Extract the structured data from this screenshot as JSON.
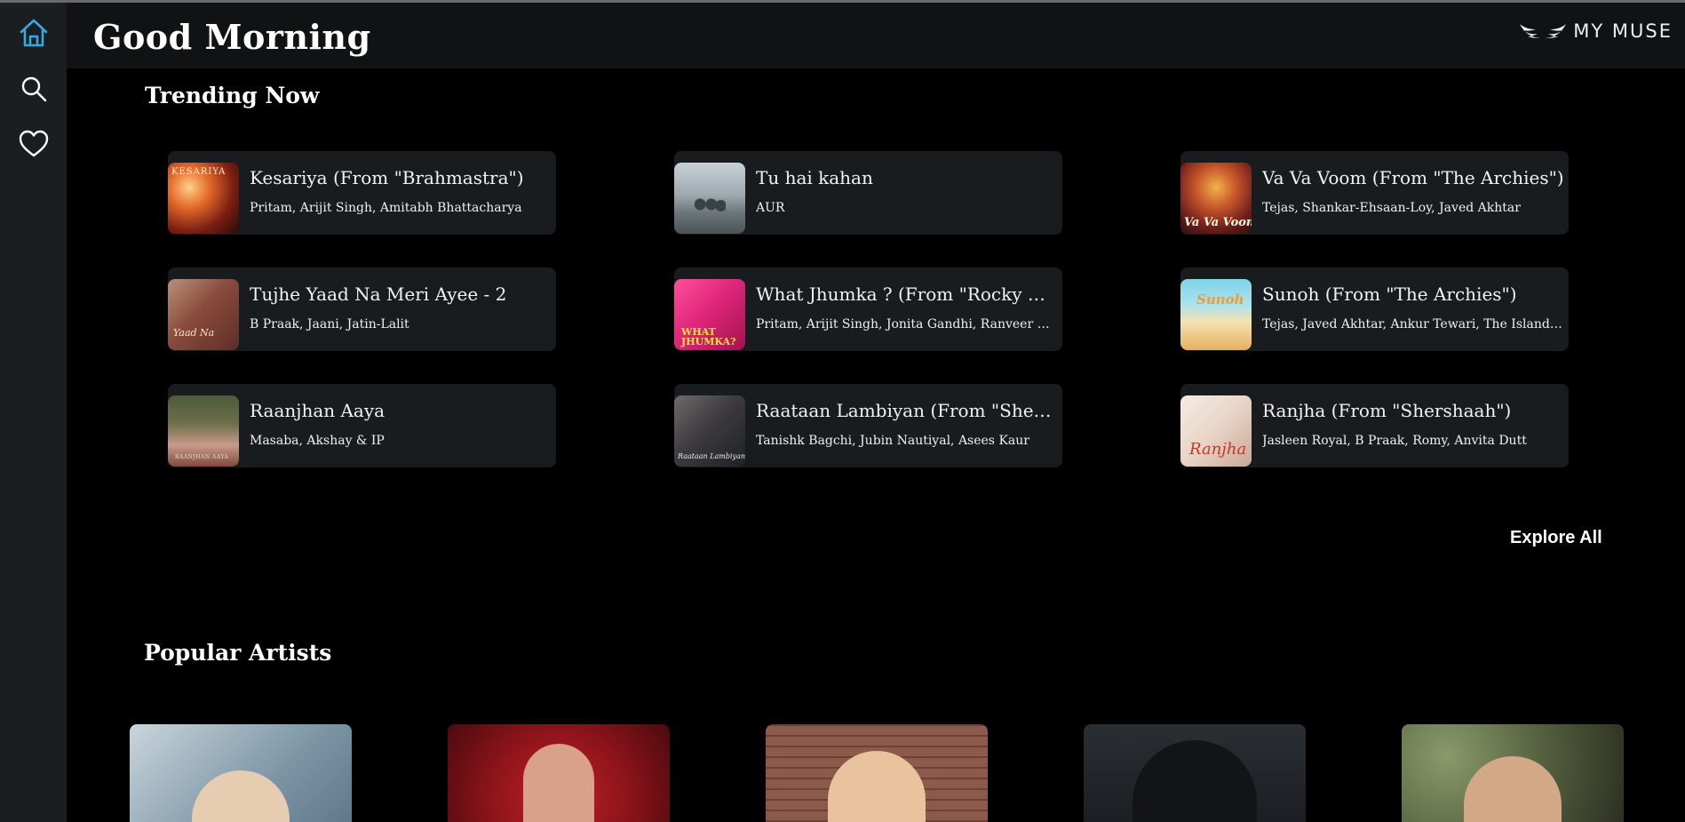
{
  "header": {
    "greeting": "Good Morning",
    "logo_text": "MY MUSE"
  },
  "sidebar": {
    "items": [
      {
        "name": "home",
        "icon": "home-icon",
        "active": true
      },
      {
        "name": "search",
        "icon": "search-icon",
        "active": false
      },
      {
        "name": "favorites",
        "icon": "heart-icon",
        "active": false
      }
    ],
    "active_color": "#38a9e0"
  },
  "trending": {
    "title": "Trending Now",
    "explore_label": "Explore All",
    "songs": [
      {
        "title": "Kesariya (From \"Brahmastra\")",
        "artists": "Pritam, Arijit Singh, Amitabh Bhattacharya",
        "thumb_text": "KESARIYA"
      },
      {
        "title": "Tu hai kahan",
        "artists": "AUR",
        "thumb_text": ""
      },
      {
        "title": "Va Va Voom (From \"The Archies\")",
        "artists": "Tejas, Shankar-Ehsaan-Loy, Javed Akhtar",
        "thumb_text": "Va Va Voom"
      },
      {
        "title": "Tujhe Yaad Na Meri Ayee - 2",
        "artists": "B Praak, Jaani, Jatin-Lalit",
        "thumb_text": "Yaad Na"
      },
      {
        "title": "What Jhumka ? (From \"Rocky Aur Rani Kii Prem Kahaani\")",
        "artists": "Pritam, Arijit Singh, Jonita Gandhi, Ranveer Singh",
        "thumb_text": "WHAT JHUMKA?"
      },
      {
        "title": "Sunoh (From \"The Archies\")",
        "artists": "Tejas, Javed Akhtar, Ankur Tewari, The Islanders",
        "thumb_text": "Sunoh"
      },
      {
        "title": "Raanjhan Aaya",
        "artists": "Masaba, Akshay & IP",
        "thumb_text": "RAANJHAN AAYA"
      },
      {
        "title": "Raataan Lambiyan (From \"Shershaah\")",
        "artists": "Tanishk Bagchi, Jubin Nautiyal, Asees Kaur",
        "thumb_text": "Raataan Lambiyan"
      },
      {
        "title": "Ranjha (From \"Shershaah\")",
        "artists": "Jasleen Royal, B Praak, Romy, Anvita Dutt",
        "thumb_text": "Ranjha"
      }
    ]
  },
  "artists": {
    "title": "Popular Artists",
    "items": [
      {
        "name": "artist-1"
      },
      {
        "name": "artist-2"
      },
      {
        "name": "artist-3"
      },
      {
        "name": "artist-4"
      },
      {
        "name": "artist-5"
      }
    ]
  }
}
